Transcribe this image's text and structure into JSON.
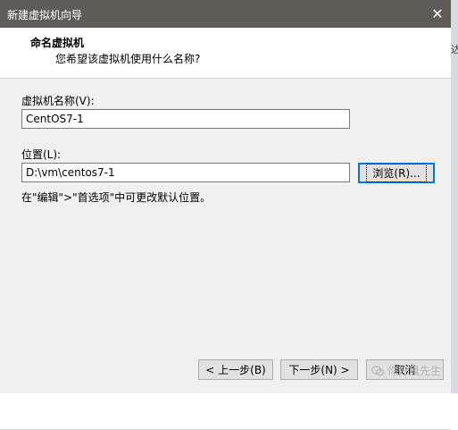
{
  "window": {
    "title": "新建虚拟机向导",
    "close_glyph": "✕"
  },
  "side_glyph": "达",
  "header": {
    "title": "命名虚拟机",
    "subtitle": "您希望该虚拟机使用什么名称?"
  },
  "form": {
    "vm_name_label": "虚拟机名称(V):",
    "vm_name_value": "CentOS7-1",
    "location_label": "位置(L):",
    "location_value": "D:\\vm\\centos7-1",
    "browse_label": "浏览(R)...",
    "hint": "在\"编辑\">\"首选项\"中可更改默认位置。"
  },
  "footer": {
    "back_label": "< 上一步(B)",
    "next_label": "下一步(N) >",
    "cancel_label": "取消"
  },
  "watermark": {
    "text": "你好晨先生"
  }
}
